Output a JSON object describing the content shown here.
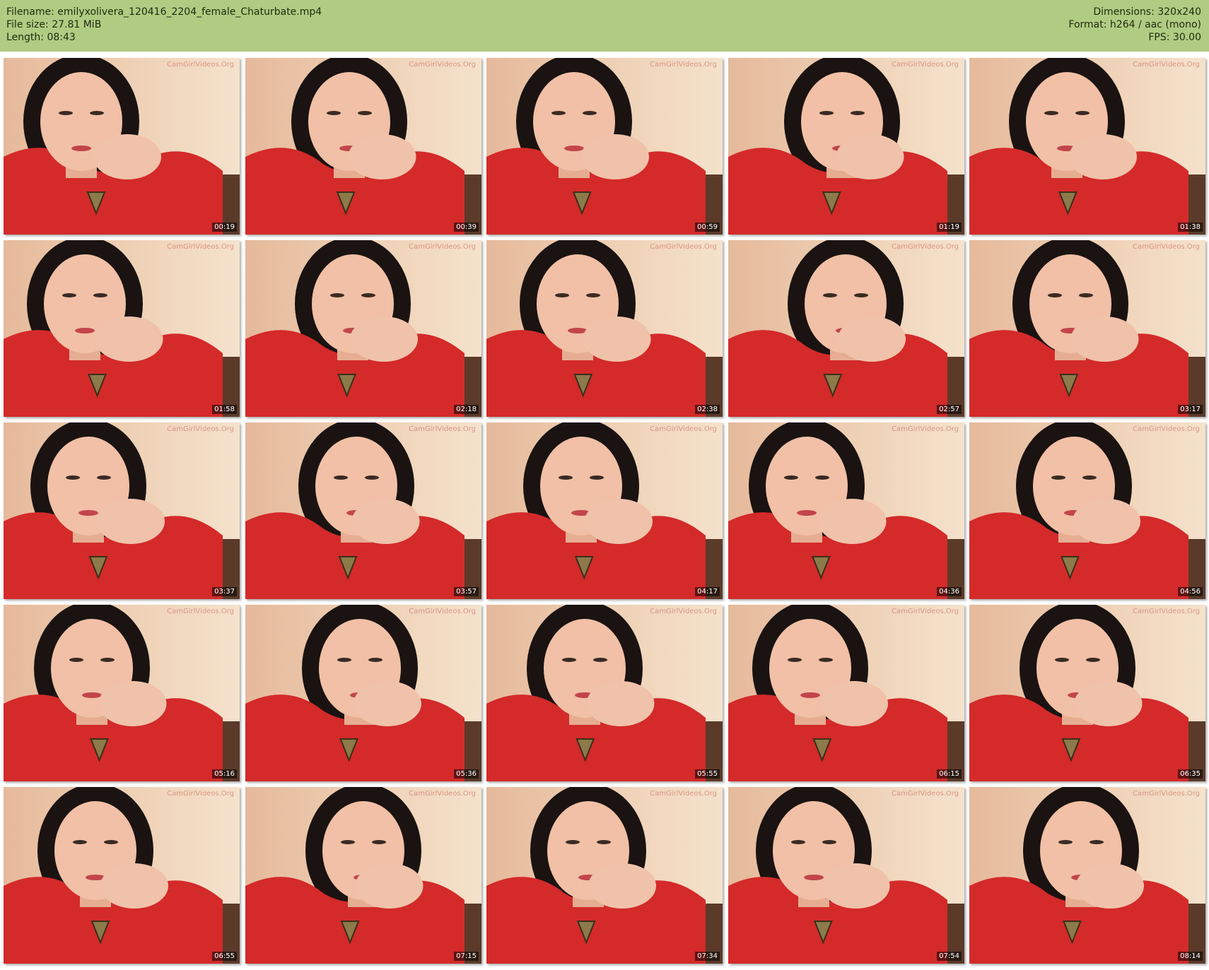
{
  "header": {
    "filename": "Filename: emilyxolivera_120416_2204_female_Chaturbate.mp4",
    "filesize": "File size: 27.81 MiB",
    "length": "Length: 08:43",
    "dimensions": "Dimensions: 320x240",
    "format": "Format: h264 / aac (mono)",
    "fps": "FPS: 30.00"
  },
  "watermark": "CamGirlVideos.Org",
  "thumbnails": [
    {
      "time": "00:19"
    },
    {
      "time": "00:39"
    },
    {
      "time": "00:59"
    },
    {
      "time": "01:19"
    },
    {
      "time": "01:38"
    },
    {
      "time": "01:58"
    },
    {
      "time": "02:18"
    },
    {
      "time": "02:38"
    },
    {
      "time": "02:57"
    },
    {
      "time": "03:17"
    },
    {
      "time": "03:37"
    },
    {
      "time": "03:57"
    },
    {
      "time": "04:17"
    },
    {
      "time": "04:36"
    },
    {
      "time": "04:56"
    },
    {
      "time": "05:16"
    },
    {
      "time": "05:36"
    },
    {
      "time": "05:55"
    },
    {
      "time": "06:15"
    },
    {
      "time": "06:35"
    },
    {
      "time": "06:55"
    },
    {
      "time": "07:15"
    },
    {
      "time": "07:34"
    },
    {
      "time": "07:54"
    },
    {
      "time": "08:14"
    }
  ],
  "colors": {
    "header_bg": "#b0cc82",
    "wall": "#efd3b8",
    "skin": "#f1c0a6",
    "hair": "#1a1311",
    "shirt": "#d42a2a",
    "pendant": "#8c7a4a"
  }
}
